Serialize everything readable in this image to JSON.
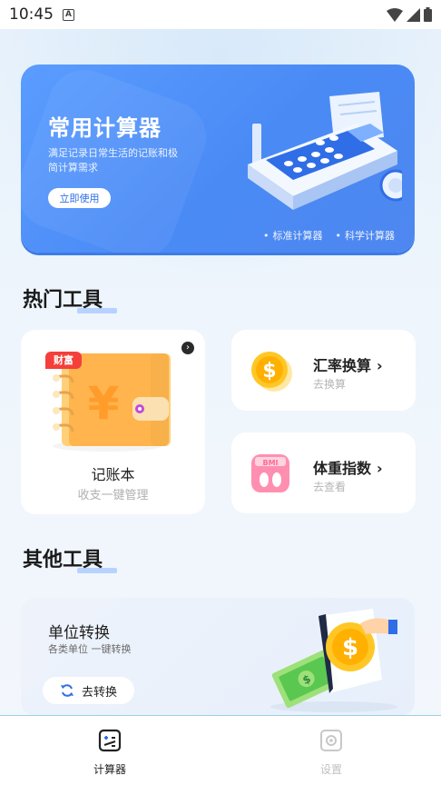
{
  "status_bar": {
    "time": "10:45",
    "notification_icon": "a-letter-icon"
  },
  "banner": {
    "title": "常用计算器",
    "subtitle": "满足记录日常生活的记账和极简计算需求",
    "button_label": "立即使用",
    "tags": [
      "标准计算器",
      "科学计算器"
    ]
  },
  "hot_tools": {
    "title": "热门工具",
    "notebook": {
      "badge": "财富",
      "label": "记账本",
      "sub": "收支一键管理"
    },
    "exchange": {
      "label": "汇率换算",
      "chevron": "›",
      "sub": "去换算"
    },
    "bmi": {
      "label": "体重指数",
      "chevron": "›",
      "sub": "去查看",
      "scale_text": "BMI"
    }
  },
  "other_tools": {
    "title": "其他工具",
    "unit": {
      "label": "单位转换",
      "sub": "各类单位 一键转换",
      "button_label": "去转换"
    }
  },
  "tabbar": {
    "tabs": [
      {
        "label": "计算器",
        "icon": "calculator-icon",
        "active": true
      },
      {
        "label": "设置",
        "icon": "settings-icon",
        "active": false
      }
    ]
  },
  "colors": {
    "primary": "#4a8af5",
    "badge": "#f43f3b",
    "accent_orange": "#ffb44d"
  }
}
